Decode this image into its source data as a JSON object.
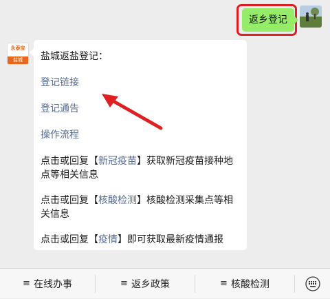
{
  "outgoing": {
    "text": "返乡登记"
  },
  "incoming": {
    "avatar_logo_top": "永泰宝",
    "avatar_logo_bottom": "盐城",
    "title": "盐城返盐登记：",
    "links": [
      "登记链接",
      "登记通告",
      "操作流程"
    ],
    "paragraphs": [
      {
        "before": "点击或回复【",
        "keyword": "新冠疫苗",
        "after": "】获取新冠疫苗接种地点等相关信息"
      },
      {
        "before": "点击或回复【",
        "keyword": "核酸检测",
        "after": "】核酸检测采集点等相关信息"
      },
      {
        "before": "点击或回复【",
        "keyword": "疫情",
        "after": "】即可获取最新疫情通报"
      }
    ]
  },
  "menu": {
    "items": [
      "在线办事",
      "返乡政策",
      "核酸检测"
    ],
    "menu_icon": "≡"
  },
  "colors": {
    "chat_bg": "#ededed",
    "outgoing_bubble": "#95ec69",
    "link": "#576b95",
    "annotation": "#e02020"
  },
  "icons": [
    "user-avatar-photo",
    "bot-logo",
    "hamburger-icon",
    "keyboard-icon",
    "annotation-arrow"
  ]
}
